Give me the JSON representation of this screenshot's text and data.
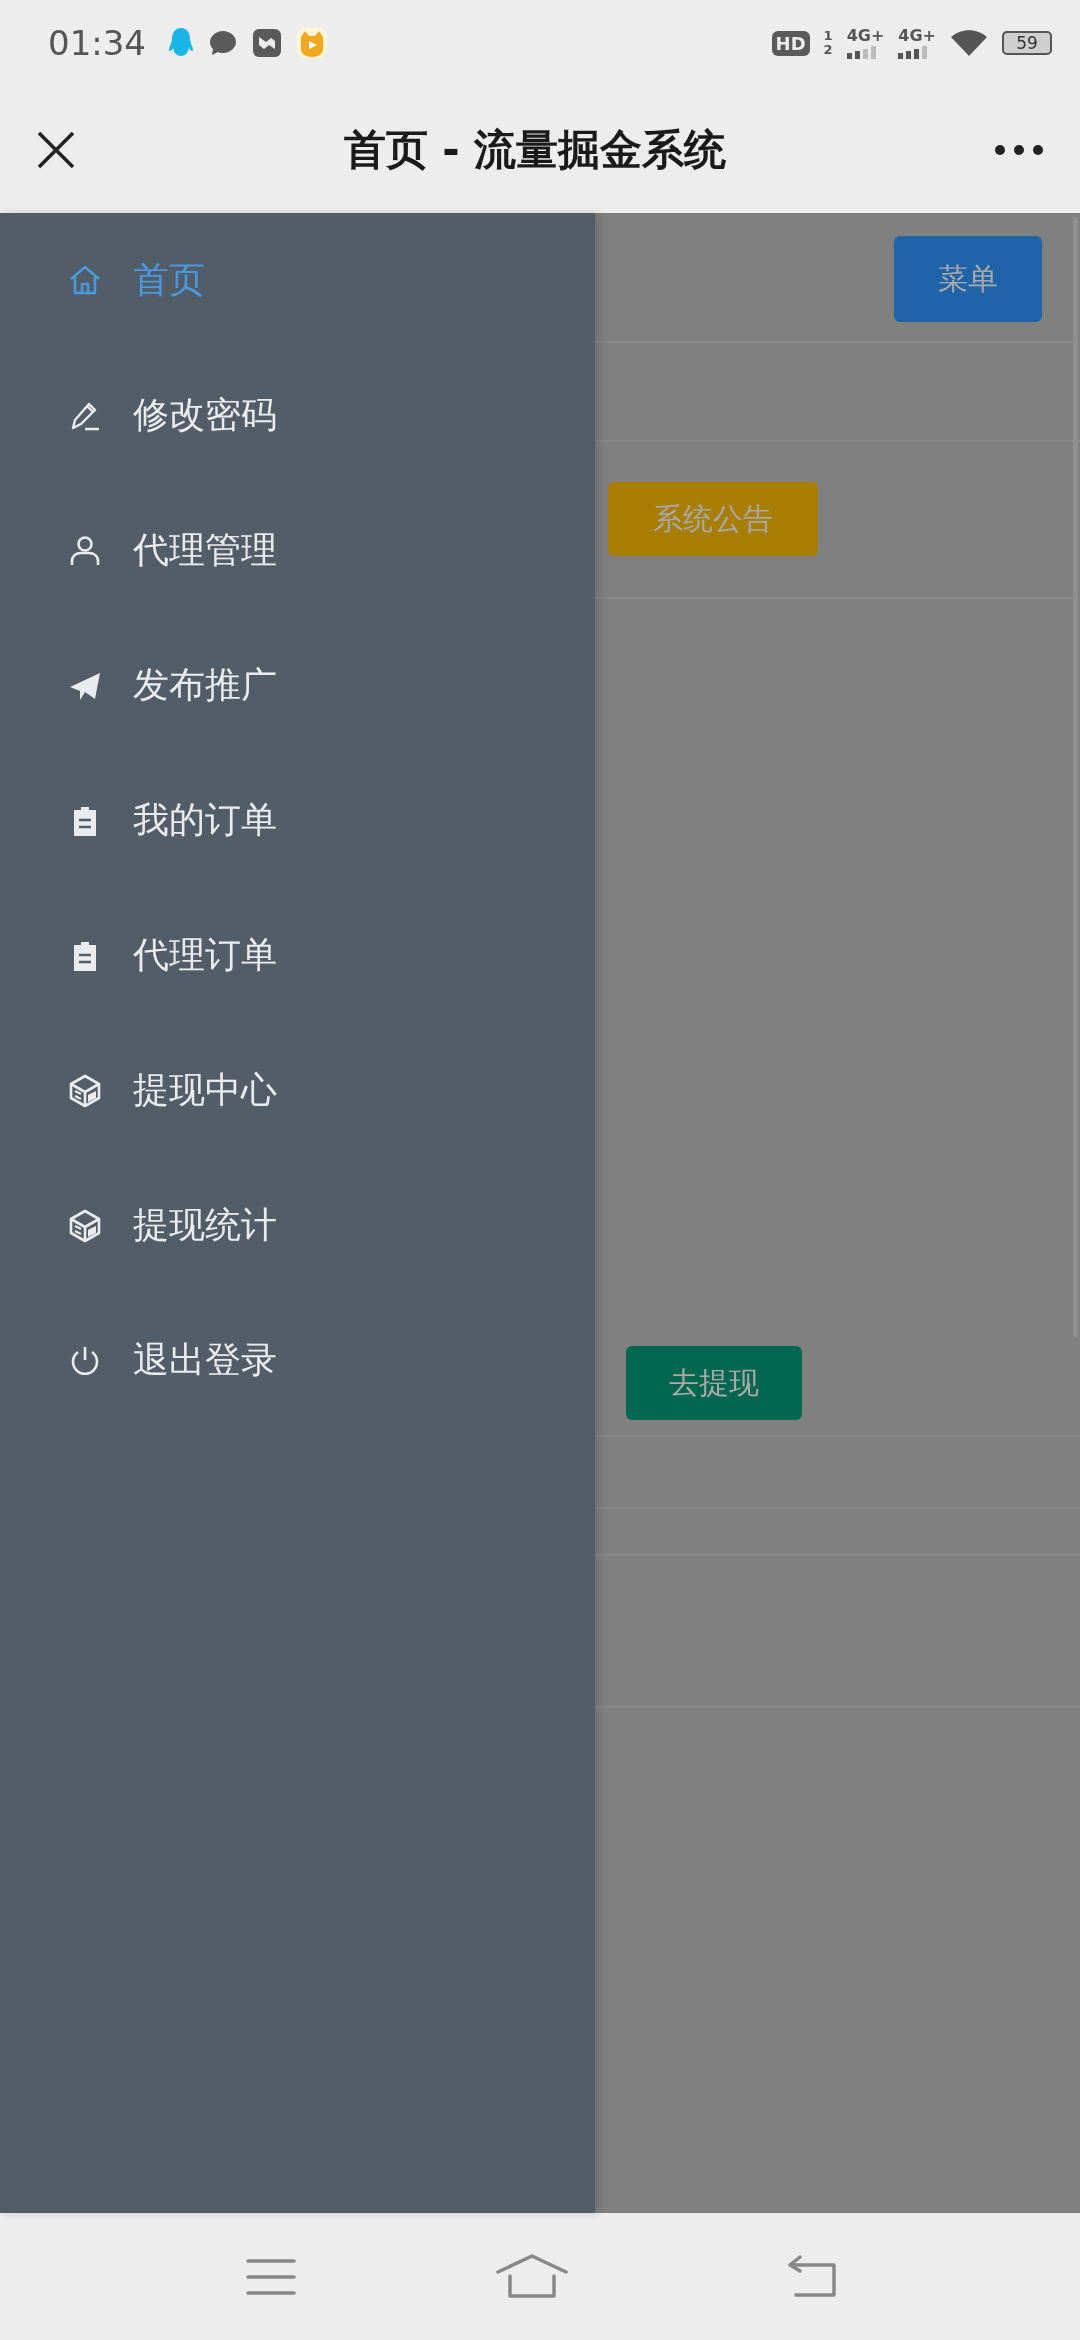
{
  "status_bar": {
    "time": "01:34",
    "hd_label": "HD",
    "sim_marks": [
      "1",
      "2"
    ],
    "networks": [
      "4G+",
      "4G+"
    ],
    "battery": "59"
  },
  "title_bar": {
    "title": "首页 - 流量掘金系统"
  },
  "drawer": {
    "items": [
      {
        "label": "首页",
        "kind": "home",
        "selected": true
      },
      {
        "label": "修改密码",
        "kind": "edit",
        "selected": false
      },
      {
        "label": "代理管理",
        "kind": "agent",
        "selected": false
      },
      {
        "label": "发布推广",
        "kind": "publish",
        "selected": false
      },
      {
        "label": "我的订单",
        "kind": "order",
        "selected": false
      },
      {
        "label": "代理订单",
        "kind": "order",
        "selected": false
      },
      {
        "label": "提现中心",
        "kind": "withdraw",
        "selected": false
      },
      {
        "label": "提现统计",
        "kind": "withdraw",
        "selected": false
      },
      {
        "label": "退出登录",
        "kind": "logout",
        "selected": false
      }
    ]
  },
  "page": {
    "menu_button": "菜单",
    "notice_button": "系统公告",
    "withdraw_button": "去提现"
  }
}
